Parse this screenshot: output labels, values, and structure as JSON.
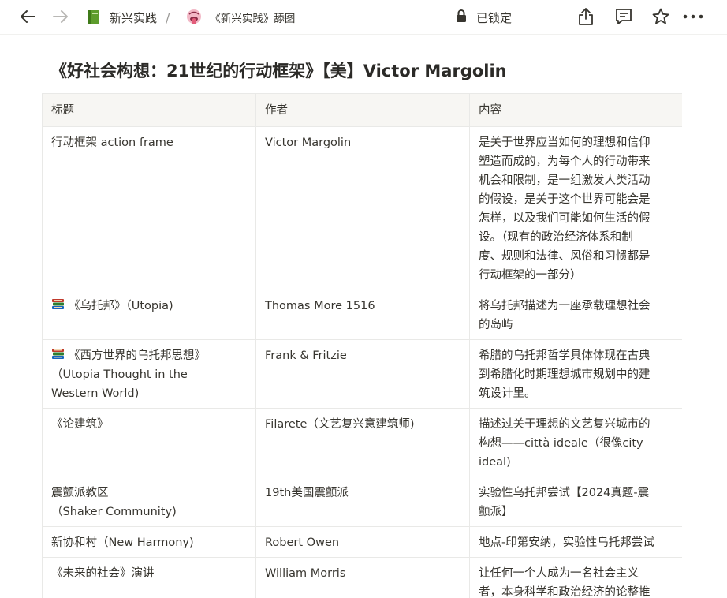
{
  "topbar": {
    "breadcrumb": [
      {
        "icon": "green-book-icon",
        "label": "新兴实践"
      },
      {
        "icon": "tongue-face-icon",
        "label": "《新兴实践》舔图"
      }
    ],
    "separator": "/",
    "lock_label": "已锁定",
    "actions": [
      "share-icon",
      "comment-icon",
      "star-icon",
      "more-icon"
    ]
  },
  "page": {
    "title": "《好社会构想：21世纪的行动框架》【美】Victor Margolin"
  },
  "table": {
    "headers": [
      "标题",
      "作者",
      "内容"
    ],
    "rows": [
      {
        "title_lines": [
          "行动框架 action frame"
        ],
        "book_icon": false,
        "author": "Victor Margolin",
        "content_lines": [
          "是关于世界应当如何的理想和信仰",
          "塑造而成的，为每个人的行动带来",
          "机会和限制，是一组激发人类活动",
          "的假设，是关于这个世界可能会是",
          "怎样，以及我们可能如何生活的假",
          "设。（现有的政治经济体系和制",
          "度、规则和法律、风俗和习惯都是",
          "行动框架的一部分）"
        ]
      },
      {
        "title_lines": [
          "《乌托邦》（Utopia)"
        ],
        "book_icon": true,
        "author": "Thomas More 1516",
        "content_lines": [
          "将乌托邦描述为一座承载理想社会",
          "的岛屿"
        ]
      },
      {
        "title_lines": [
          "《西方世界的乌托邦思想》",
          "（Utopia Thought in the",
          "Western World)"
        ],
        "book_icon": true,
        "author": "Frank & Fritzie",
        "content_lines": [
          "希腊的乌托邦哲学具体体现在古典",
          "到希腊化时期理想城市规划中的建",
          "筑设计里。"
        ]
      },
      {
        "title_lines": [
          "《论建筑》"
        ],
        "book_icon": false,
        "author": "Filarete（文艺复兴意建筑师)",
        "content_lines": [
          "描述过关于理想的文艺复兴城市的",
          "构想——città ideale（很像city",
          "ideal)"
        ]
      },
      {
        "title_lines": [
          "震颤派教区",
          "（Shaker Community)"
        ],
        "book_icon": false,
        "author": "19th美国震颤派",
        "content_lines": [
          "实验性乌托邦尝试【2024真题-震",
          "颤派】"
        ]
      },
      {
        "title_lines": [
          "新协和村（New Harmony)"
        ],
        "book_icon": false,
        "author": "Robert Owen",
        "content_lines": [
          "地点-印第安纳，实验性乌托邦尝试"
        ]
      },
      {
        "title_lines": [
          "《未来的社会》演讲"
        ],
        "book_icon": false,
        "author": "William Morris",
        "content_lines": [
          "让任何一个人成为一名社会主义",
          "者，本身科学和政治经济的论整推"
        ]
      }
    ]
  }
}
